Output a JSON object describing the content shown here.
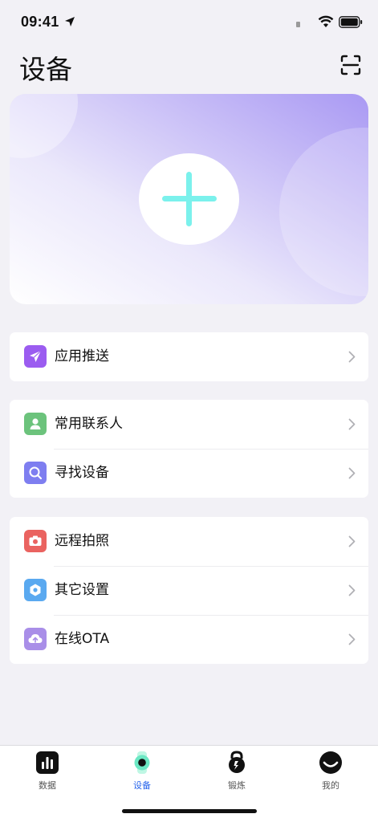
{
  "status_bar": {
    "time": "09:41"
  },
  "header": {
    "title": "设备"
  },
  "sections": [
    {
      "items": [
        {
          "label": "应用推送",
          "icon": "send-icon",
          "color": "#9b5cf0"
        }
      ]
    },
    {
      "items": [
        {
          "label": "常用联系人",
          "icon": "contact-icon",
          "color": "#6cc37c"
        },
        {
          "label": "寻找设备",
          "icon": "search-icon",
          "color": "#7e7ef0"
        }
      ]
    },
    {
      "items": [
        {
          "label": "远程拍照",
          "icon": "camera-icon",
          "color": "#ea6360"
        },
        {
          "label": "其它设置",
          "icon": "settings-hex-icon",
          "color": "#5aa9f0"
        },
        {
          "label": "在线OTA",
          "icon": "cloud-upload-icon",
          "color": "#a98ee8"
        }
      ]
    }
  ],
  "tab_bar": {
    "tabs": [
      {
        "label": "数据",
        "icon": "chart-icon",
        "active": false
      },
      {
        "label": "设备",
        "icon": "watch-icon",
        "active": true
      },
      {
        "label": "锻炼",
        "icon": "kettlebell-icon",
        "active": false
      },
      {
        "label": "我的",
        "icon": "smile-icon",
        "active": false
      }
    ]
  },
  "colors": {
    "accent": "#2563eb",
    "plus": "#7bf1ec",
    "banner": "#a999f3"
  }
}
